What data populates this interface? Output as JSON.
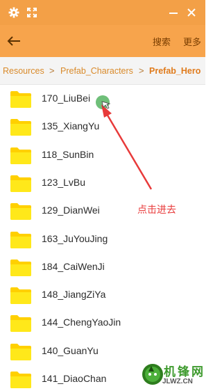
{
  "titlebar": {
    "settings_icon": "gear-icon",
    "resize_icon": "expand-icon",
    "minimize_icon": "minimize-icon",
    "close_icon": "close-icon"
  },
  "toolbar": {
    "back_icon": "back-arrow-icon",
    "search_label": "搜索",
    "more_label": "更多"
  },
  "breadcrumb": {
    "items": [
      "Resources",
      "Prefab_Characters",
      "Prefab_Hero"
    ],
    "separator": ">"
  },
  "folders": [
    "170_LiuBei",
    "135_XiangYu",
    "118_SunBin",
    "123_LvBu",
    "129_DianWei",
    "163_JuYouJing",
    "184_CaiWenJi",
    "148_JiangZiYa",
    "144_ChengYaoJin",
    "140_GuanYu",
    "141_DiaoChan"
  ],
  "annotation": {
    "text": "点击进去"
  },
  "watermark": {
    "logo_text": "机锋网",
    "site": "JLWZ.CN"
  },
  "colors": {
    "accent": "#f7a44c",
    "folder": "#ffe000",
    "annotation": "#e83a3a"
  }
}
